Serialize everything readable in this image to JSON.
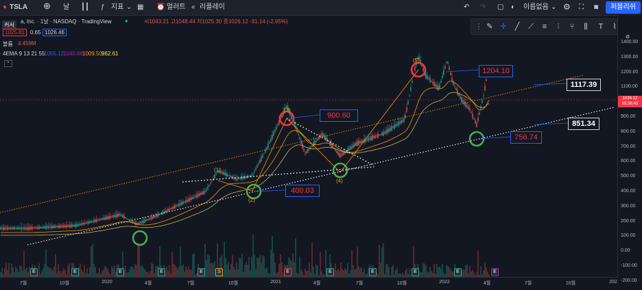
{
  "topbar": {
    "symbol": "TSLA",
    "interval": "날",
    "indicators": "지표",
    "alert": "얼러트",
    "replay": "리플레이",
    "layout_name": "이름없음",
    "publish": "퍼블리쉬"
  },
  "legend": {
    "name": "a, Inc. · 1날 · NASDAQ · TradingView",
    "ohlc": "시1043.21 고1048.44 저1025.30 종1026.12 -31.14 (-2.95%)",
    "tooltip": "커서",
    "price_a": "1025.81",
    "spread": "0.65",
    "price_b": "1026.46",
    "volume_label": "볼륨",
    "volume_value": "4.459M",
    "ema_label": "4EMA 9 13 21 55",
    "ema1": "1055.12",
    "ema2": "1040.68",
    "ema3": "1009.50",
    "ema4": "962.61"
  },
  "colors": {
    "up": "#26a69a",
    "down": "#ef5350",
    "ema_orange": "#ff9800",
    "ema_yellow": "#ffeb3b",
    "callout_red": "#f23645",
    "callout_blue": "#2962ff"
  },
  "callouts": {
    "c1204": "1204.10",
    "c1117": "1117.39",
    "c900": "900.60",
    "c851": "851.34",
    "c756": "756.74",
    "c400": "400.03"
  },
  "waves": {
    "w1": "(1)",
    "w2": "(2)",
    "w3": "(3)",
    "w4": "(4)",
    "w5": "(5)"
  },
  "last_price": {
    "value": "1026.12",
    "countdown": "05:36:43"
  },
  "y_axis": [
    "1400.00",
    "1300.00",
    "1200.00",
    "1100.00",
    "1000.00",
    "900.00",
    "800.00",
    "700.00",
    "600.00",
    "500.00",
    "400.00",
    "300.00",
    "200.00",
    "100.00",
    "0.00",
    "-100.00",
    "-200.00"
  ],
  "x_axis": [
    "7월",
    "10월",
    "2020",
    "4월",
    "7월",
    "10월",
    "2021",
    "4월",
    "7월",
    "10월",
    "2022",
    "4월",
    "7월",
    "10월",
    "202"
  ],
  "events": [
    "E",
    "E",
    "E",
    "E",
    "E",
    "S",
    "E",
    "E",
    "E",
    "E",
    "E",
    "E"
  ]
}
